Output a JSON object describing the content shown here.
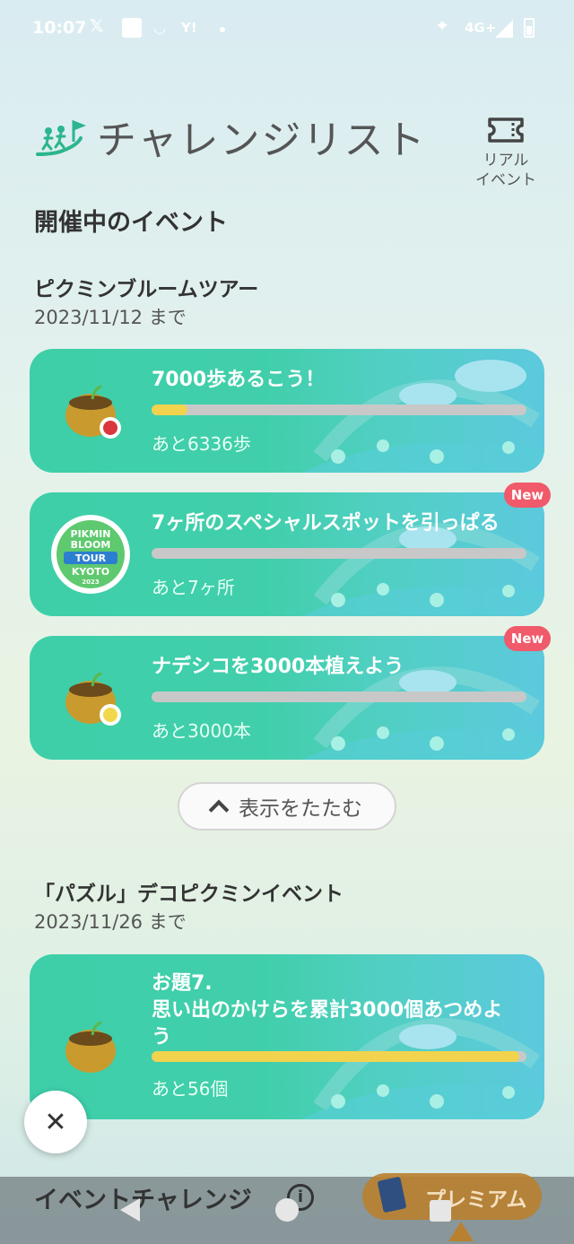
{
  "status_bar": {
    "time": "10:07",
    "icons_left": [
      "x-icon",
      "notification-icon",
      "cat-icon",
      "yahoo-icon",
      "dot-icon"
    ],
    "network": "4G+",
    "icons_right": [
      "location-icon",
      "signal-icon",
      "battery-icon"
    ]
  },
  "header": {
    "title": "チャレンジリスト",
    "real_event_label": "リアル\nイベント"
  },
  "section_title": "開催中のイベント",
  "events": [
    {
      "name": "ピクミンブルームツアー",
      "date": "2023/11/12 まで",
      "challenges": [
        {
          "title": "7000歩あるこう！",
          "remaining": "あと6336歩",
          "progress": 0.095,
          "badge": "",
          "icon": "golden-pot-red-pikmin-icon"
        },
        {
          "title": "7ヶ所のスペシャルスポットを引っぱる",
          "remaining": "あと7ヶ所",
          "progress": 0,
          "badge": "New",
          "icon": "pikmin-bloom-tour-kyoto-badge"
        },
        {
          "title": "ナデシコを3000本植えよう",
          "remaining": "あと3000本",
          "progress": 0,
          "badge": "New",
          "icon": "golden-pot-yellow-pikmin-icon"
        }
      ]
    },
    {
      "name": "「パズル」デコピクミンイベント",
      "date": "2023/11/26 まで",
      "challenges": [
        {
          "title": "お題7.\n思い出のかけらを累計3000個あつめよ\nう",
          "remaining": "あと56個",
          "progress": 0.98,
          "badge": "",
          "icon": "golden-pot-icon"
        }
      ]
    }
  ],
  "badge_logo": {
    "line1": "PIKMIN",
    "line2": "BLOOM",
    "line3": "TOUR",
    "line4": "KYOTO",
    "line5": "2023"
  },
  "collapse_label": "表示をたたむ",
  "close_label": "✕",
  "bottom": {
    "title": "イベントチャレンジ",
    "info": "i",
    "premium_label": "プレミアム"
  },
  "colors": {
    "card_green": "#40cfaa",
    "progress_fill": "#f2d34d",
    "new_badge": "#f05a6a",
    "premium": "#b9802f"
  }
}
